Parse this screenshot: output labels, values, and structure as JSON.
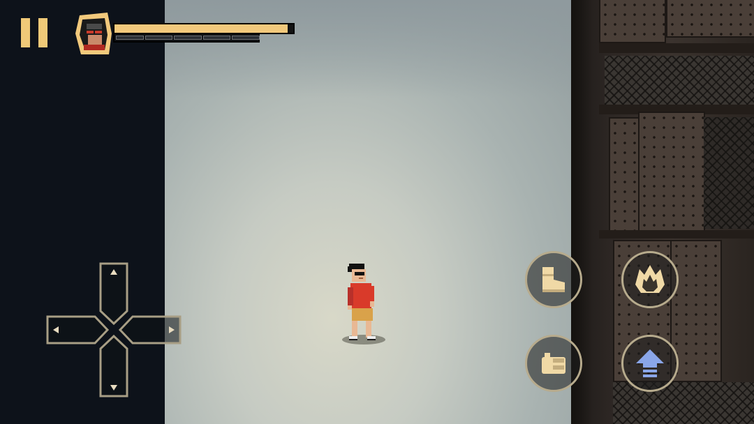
{
  "hud": {
    "health_fraction": 0.97,
    "special_segments": 5,
    "special_filled": 0
  },
  "controls": {
    "pause_icon": "pause-icon",
    "kick_icon": "boot-icon",
    "punch_icon": "fist-icon",
    "special_icon": "flame-icon",
    "jump_icon": "up-arrow-icon",
    "dpad_arrows": [
      "up-arrow",
      "down-arrow",
      "left-arrow",
      "right-arrow"
    ]
  },
  "colors": {
    "hud_gold": "#f0c978",
    "button_ring": "#b7ab8d",
    "jump_blue": "#8aa6e8",
    "player_shirt": "#d93a2a",
    "player_shorts": "#d9a24a"
  }
}
